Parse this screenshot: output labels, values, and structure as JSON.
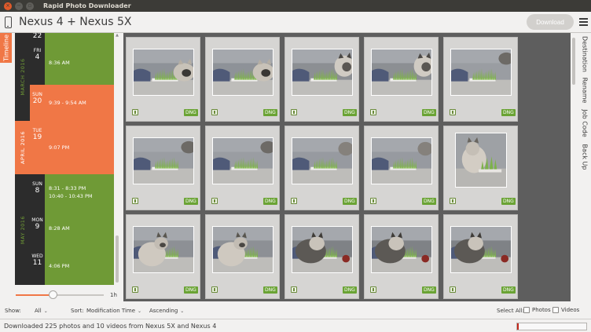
{
  "window": {
    "title": "Rapid Photo Downloader"
  },
  "header": {
    "device_title": "Nexus 4 + Nexus 5X",
    "download_label": "Download"
  },
  "left_tab": {
    "label": "Timeline"
  },
  "timeline": {
    "months": [
      {
        "label": "MARCH 2016",
        "highlight": false
      },
      {
        "label": "APRIL 2016",
        "highlight": true
      },
      {
        "label": "MAY 2016",
        "highlight": false
      }
    ],
    "rows": [
      {
        "dow": "",
        "day": "22",
        "times": [],
        "highlight": false
      },
      {
        "dow": "FRI",
        "day": "4",
        "times": [
          "8:36 AM"
        ],
        "highlight": false
      },
      {
        "dow": "SUN",
        "day": "20",
        "times": [
          "9:39 - 9:54 AM"
        ],
        "highlight": true
      },
      {
        "dow": "TUE",
        "day": "19",
        "times": [
          "9:07 PM"
        ],
        "highlight": true
      },
      {
        "dow": "SUN",
        "day": "8",
        "times": [
          "8:31 - 8:33 PM",
          "10:40 - 10:43 PM"
        ],
        "highlight": false
      },
      {
        "dow": "MON",
        "day": "9",
        "times": [
          "8:28 AM"
        ],
        "highlight": false
      },
      {
        "dow": "WED",
        "day": "11",
        "times": [
          "4:06 PM"
        ],
        "highlight": false
      }
    ]
  },
  "slider": {
    "label": "1h",
    "value": 0.42
  },
  "grid": {
    "items": [
      {
        "badge": "DNG",
        "kind": "a"
      },
      {
        "badge": "DNG",
        "kind": "a"
      },
      {
        "badge": "DNG",
        "kind": "b"
      },
      {
        "badge": "DNG",
        "kind": "b"
      },
      {
        "badge": "DNG",
        "kind": "c"
      },
      {
        "badge": "DNG",
        "kind": "c"
      },
      {
        "badge": "DNG",
        "kind": "c"
      },
      {
        "badge": "DNG",
        "kind": "d"
      },
      {
        "badge": "DNG",
        "kind": "d"
      },
      {
        "badge": "DNG",
        "kind": "portrait"
      },
      {
        "badge": "DNG",
        "kind": "e"
      },
      {
        "badge": "DNG",
        "kind": "e"
      },
      {
        "badge": "DNG",
        "kind": "f"
      },
      {
        "badge": "DNG",
        "kind": "f"
      },
      {
        "badge": "DNG",
        "kind": "f"
      }
    ]
  },
  "right_tabs": [
    "Destination",
    "Rename",
    "Job Code",
    "Back Up"
  ],
  "bottombar": {
    "show_label": "Show:",
    "show_value": "All",
    "sort_label": "Sort:",
    "sort_value": "Modification Time",
    "order_value": "Ascending",
    "select_all_label": "Select All:",
    "photos_label": "Photos",
    "videos_label": "Videos"
  },
  "status": {
    "text": "Downloaded 225 photos and 10 videos from Nexus 5X and Nexus 4",
    "progress": 0.02
  },
  "colors": {
    "accent": "#f07746",
    "timeline_green": "#6f9a36",
    "timeline_dark": "#2c2c2c",
    "badge_green": "#6aa334",
    "progress_red": "#c1271b"
  }
}
